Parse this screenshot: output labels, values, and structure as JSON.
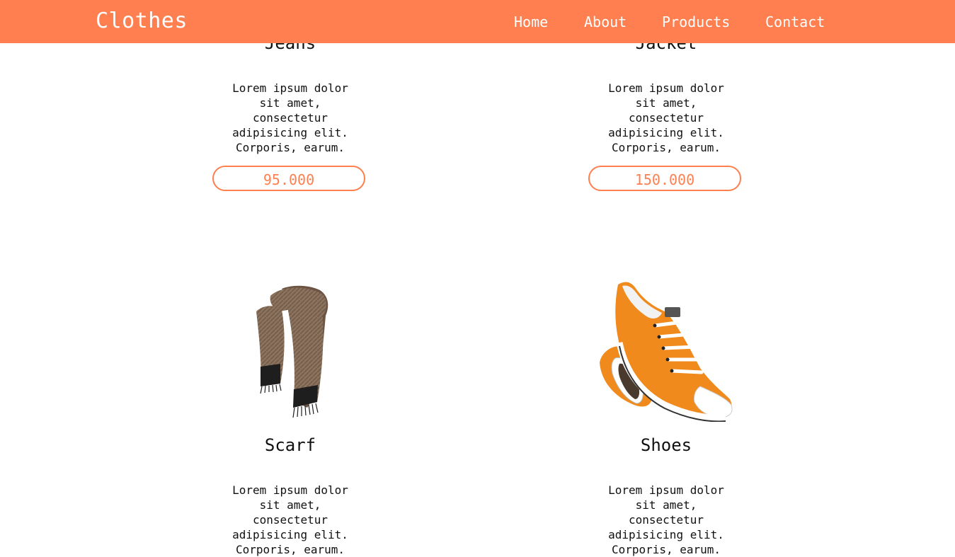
{
  "brand": "Clothes",
  "nav": {
    "home": "Home",
    "about": "About",
    "products": "Products",
    "contact": "Contact"
  },
  "colors": {
    "accent": "#ff7f50"
  },
  "products": [
    {
      "name": "Jeans",
      "description": "Lorem ipsum dolor sit amet, consectetur adipisicing elit. Corporis, earum.",
      "price": "95.000"
    },
    {
      "name": "Jacket",
      "description": "Lorem ipsum dolor sit amet, consectetur adipisicing elit. Corporis, earum.",
      "price": "150.000"
    },
    {
      "name": "Scarf",
      "image_icon": "scarf-image",
      "description": "Lorem ipsum dolor sit amet, consectetur adipisicing elit. Corporis, earum."
    },
    {
      "name": "Shoes",
      "image_icon": "sneaker-image",
      "description": "Lorem ipsum dolor sit amet, consectetur adipisicing elit. Corporis, earum."
    }
  ]
}
